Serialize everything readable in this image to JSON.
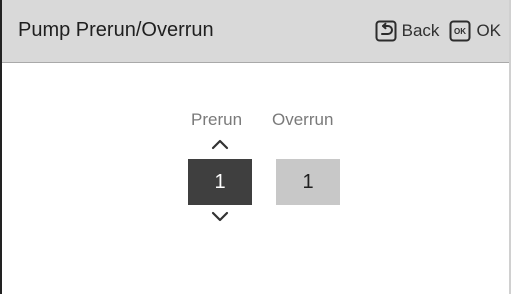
{
  "header": {
    "title": "Pump Prerun/Overrun",
    "back_label": "Back",
    "ok_label": "OK",
    "ok_icon_text": "OK",
    "back_icon": "return-arrow-icon",
    "ok_icon": "ok-key-icon"
  },
  "settings": {
    "prerun": {
      "label": "Prerun",
      "value": "1",
      "selected": true
    },
    "overrun": {
      "label": "Overrun",
      "value": "1",
      "selected": false
    }
  },
  "icons": {
    "increase": "chevron-up-icon",
    "decrease": "chevron-down-icon"
  },
  "colors": {
    "header_background": "#d9d9d9",
    "selected_field": "#3f3f3f",
    "unselected_field": "#c8c8c8",
    "label_text": "#7a7a7a"
  }
}
